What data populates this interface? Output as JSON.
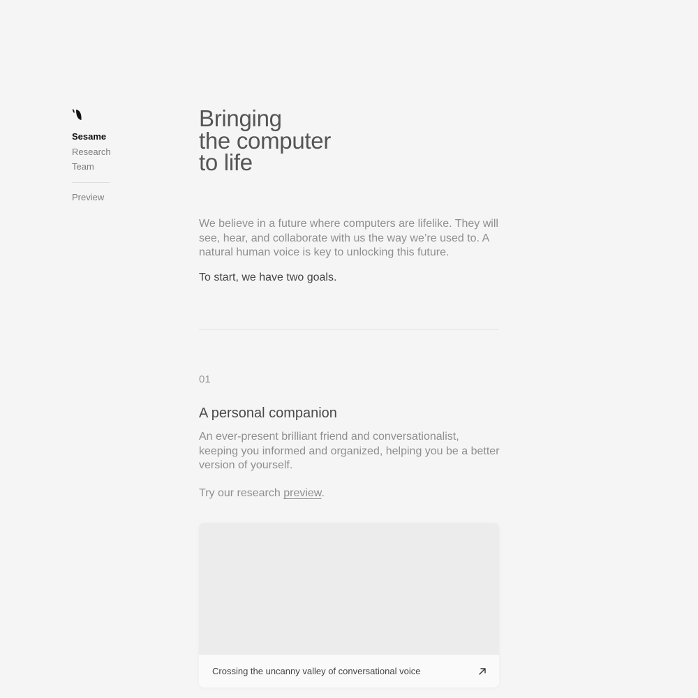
{
  "sidebar": {
    "logo_icon": "sesame-leaf-icon",
    "items": [
      {
        "label": "Sesame",
        "active": true
      },
      {
        "label": "Research",
        "active": false
      },
      {
        "label": "Team",
        "active": false
      }
    ],
    "secondary": [
      {
        "label": "Preview"
      }
    ]
  },
  "hero": {
    "title_lines": [
      "Bringing",
      "the computer",
      "to life"
    ],
    "intro": "We believe in a future where computers are lifelike. They will see, hear, and collaborate with us the way we’re used to. A natural human voice is key to unlocking this future.",
    "goals": "To start, we have two goals."
  },
  "section": {
    "number": "01",
    "title": "A personal companion",
    "description": "An ever-present brilliant friend and conversationalist, keeping you informed and organized, helping you be a better version of yourself.",
    "try_prefix": "Try our research ",
    "try_link": "preview",
    "try_suffix": "."
  },
  "card": {
    "title": "Crossing the uncanny valley of conversational voice",
    "arrow_icon": "arrow-up-right-icon"
  },
  "colors": {
    "background": "#f5f5f5",
    "text_primary": "#111111",
    "text_muted": "#8f8f8f",
    "heading": "#555555"
  }
}
